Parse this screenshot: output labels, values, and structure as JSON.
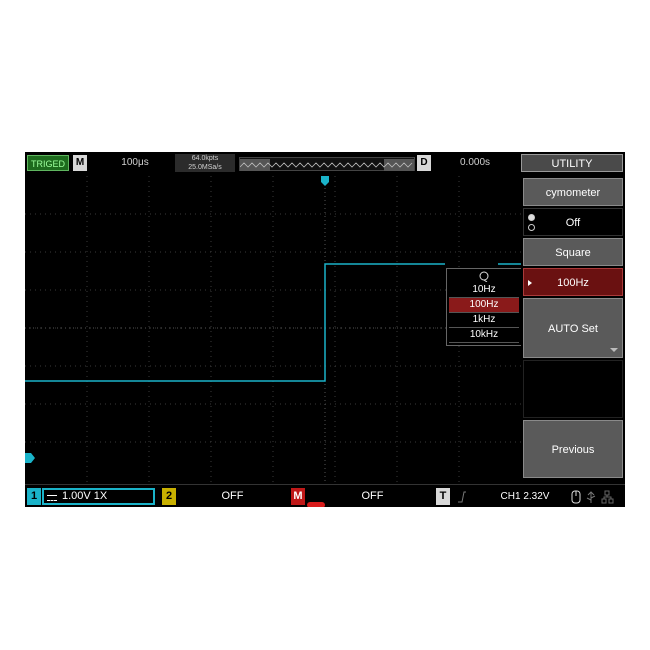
{
  "topbar": {
    "trig_status": "TRIGED",
    "mode_label": "M",
    "timebase": "100μs",
    "memory_depth": "64.0kpts",
    "sample_rate": "25.0MSa/s",
    "delay_label": "D",
    "delay_value": "0.000s",
    "menu_title": "UTILITY"
  },
  "menu": {
    "item1": "cymometer",
    "item2": "Off",
    "item3": "Square",
    "item4": "100Hz",
    "item5": "AUTO Set",
    "item7": "Previous"
  },
  "popup": {
    "options": [
      "10Hz",
      "100Hz",
      "1kHz",
      "10kHz"
    ],
    "selected": "100Hz"
  },
  "bottombar": {
    "ch1_num": "1",
    "ch1_scale": "1.00V 1X",
    "ch2_num": "2",
    "ch2_value": "OFF",
    "math_num": "M",
    "math_value": "OFF",
    "trig_num": "T",
    "trig_info": "CH1 2.32V"
  },
  "colors": {
    "ch1": "#1ab3c9",
    "ch2": "#c8b000",
    "math": "#c01818",
    "selected": "#8a1a1a",
    "triged": "#1d6b1d"
  },
  "icons": {
    "edge": "rising-edge-icon",
    "refresh": "refresh-icon",
    "usb": "usb-icon",
    "lock": "lock-icon"
  }
}
